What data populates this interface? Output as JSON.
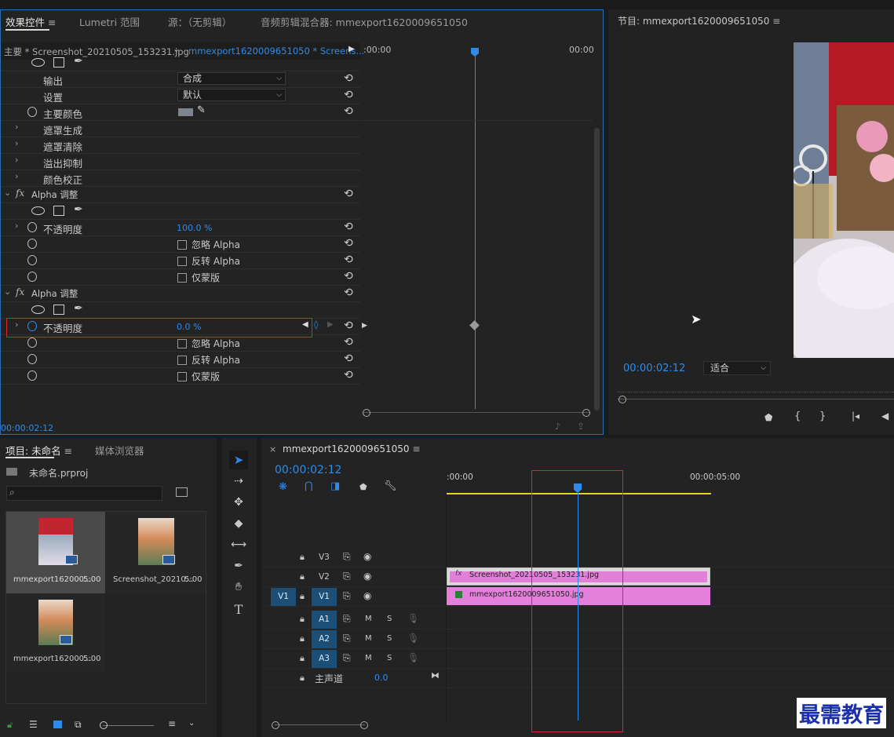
{
  "effect_controls": {
    "tabs": [
      "效果控件",
      "Lumetri 范围",
      "源：（无剪辑）",
      "音频剪辑混合器: mmexport1620009651050"
    ],
    "master_label": "主要 * Screenshot_20210505_153231.jpg",
    "seq_label": "mmexport1620009651050 * Screens...",
    "time_left": ":00:00",
    "time_right": "00:00",
    "rows": {
      "output_label": "输出",
      "output_value": "合成",
      "settings_label": "设置",
      "settings_value": "默认",
      "key_color_label": "主要颜色",
      "matte_gen": "遮罩生成",
      "matte_clean": "遮罩清除",
      "spill": "溢出抑制",
      "color_correct": "颜色校正",
      "alpha_adjust": "Alpha 调整",
      "opacity_label": "不透明度",
      "opacity1": "100.0 %",
      "opacity2": "0.0 %",
      "ignore_alpha": "忽略 Alpha",
      "invert_alpha": "反转 Alpha",
      "mask_only": "仅蒙版"
    },
    "timecode": "00:00:02:12"
  },
  "program": {
    "title": "节目: mmexport1620009651050",
    "timecode": "00:00:02:12",
    "fit": "适合"
  },
  "project": {
    "tabs": [
      "项目: 未命名",
      "媒体浏览器"
    ],
    "file": "未命名.prproj",
    "items": [
      {
        "name": "mmexport162000...",
        "dur": "5:00"
      },
      {
        "name": "Screenshot_20210...",
        "dur": "5:00"
      },
      {
        "name": "mmexport162000...",
        "dur": "5:00"
      }
    ]
  },
  "timeline": {
    "close": "×",
    "title": "mmexport1620009651050",
    "timecode": "00:00:02:12",
    "ruler_start": ":00:00",
    "ruler_mark": "00:00:05:00",
    "tracks": {
      "v3": "V3",
      "v2": "V2",
      "v1": "V1",
      "src_v1": "V1",
      "a1": "A1",
      "a2": "A2",
      "a3": "A3",
      "m": "M",
      "s": "S",
      "master_label": "主声道",
      "master_value": "0.0"
    },
    "clips": {
      "v2": "Screenshot_20210505_153231.jpg",
      "v1": "mmexport1620009651050.jpg"
    }
  },
  "watermark": "最需教育",
  "colors": {
    "accent": "#2d8ceb",
    "highlight": "#d8d8d8",
    "clip": "#e57fdc",
    "annotation": "#d62a2a",
    "work_area": "#e3d614"
  }
}
